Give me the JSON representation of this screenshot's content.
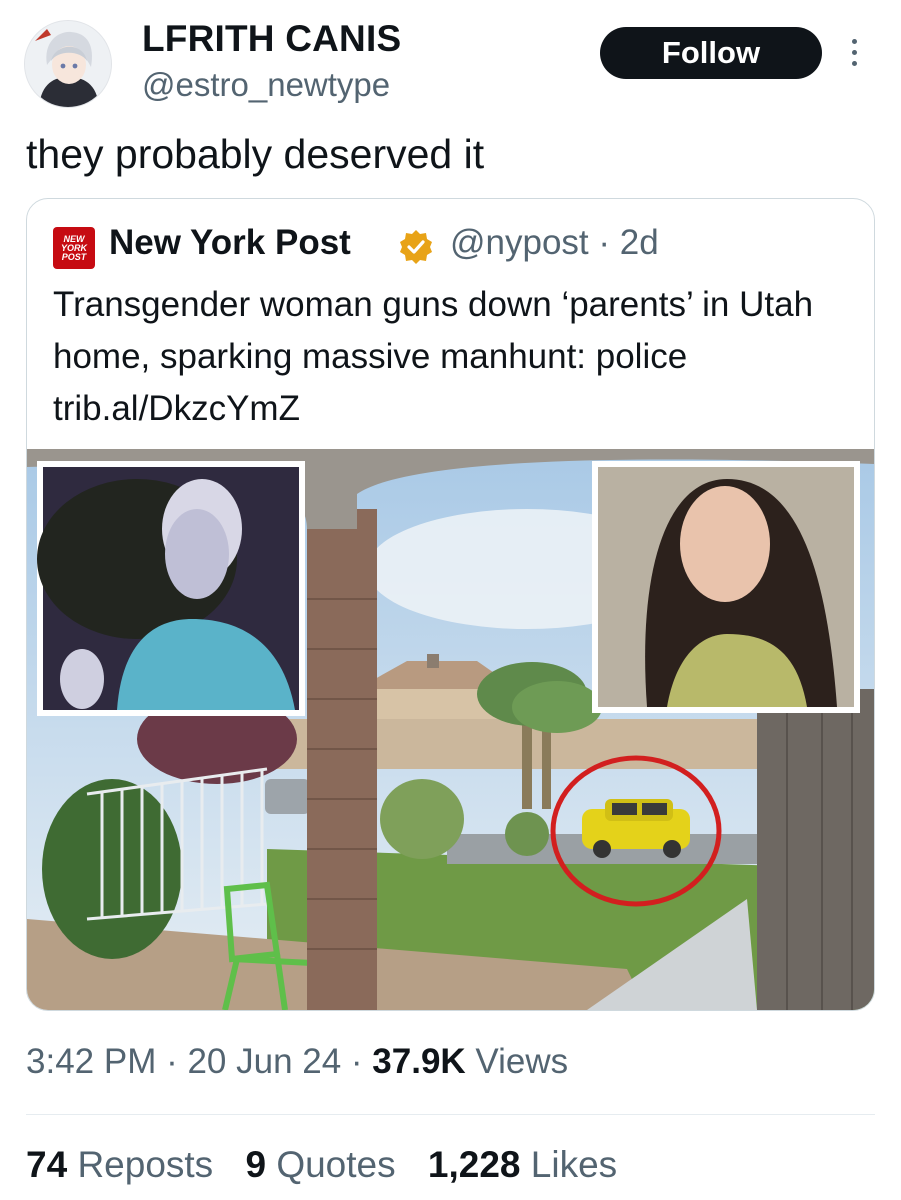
{
  "author": {
    "display_name": "LFRITH CANIS",
    "handle": "@estro_newtype",
    "avatar_icon": "anime-avatar"
  },
  "follow_label": "Follow",
  "tweet_text": "they probably deserved it",
  "quoted": {
    "logo_lines": [
      "NEW",
      "YORK",
      "POST"
    ],
    "name": "New York Post",
    "verified_icon": "gold-verified-badge-icon",
    "handle_time": "@nypost · 2d",
    "text": "Transgender woman guns down ‘parents’ in Utah home, sparking massive manhunt: police trib.al/DkzcYmZ"
  },
  "meta": {
    "time_date": "3:42 PM · 20 Jun 24 · ",
    "views_count": "37.9K",
    "views_label": " Views"
  },
  "stats": {
    "reposts_count": "74",
    "reposts_label": "Reposts",
    "quotes_count": "9",
    "quotes_label": "Quotes",
    "likes_count": "1,228",
    "likes_label": "Likes"
  },
  "colors": {
    "nypost_red": "#c60b12",
    "badge_gold": "#e8a317",
    "highlight_circle": "#d21f1f",
    "car_yellow": "#e4d21a"
  }
}
